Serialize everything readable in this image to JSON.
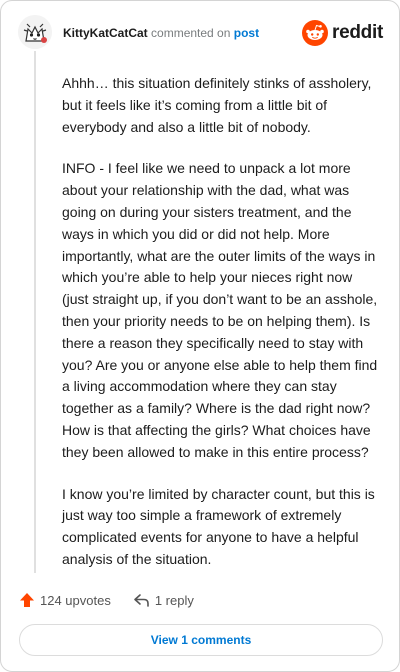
{
  "comment": {
    "username": "KittyKatCatCat",
    "verb": "commented on",
    "post_link": "post",
    "brand": "reddit",
    "paragraphs": [
      "Ahhh… this situation definitely stinks of assholery, but it feels like it’s coming from a little bit of everybody and also a little bit of nobody.",
      "INFO - I feel like we need to unpack a lot more about your relationship with the dad, what was going on during your sisters treatment, and the ways in which you did or did not help. More importantly, what are the outer limits of the ways in which you’re able to help your nieces right now (just straight up, if you don’t want to be an asshole, then your priority needs to be on helping them). Is there a reason they specifically need to stay with you? Are you or anyone else able to help them find a living accommodation where they can stay together as a family? Where is the dad right now? How is that affecting the girls? What choices have they been allowed to make in this entire process?",
      "I know you’re limited by character count, but this is just way too simple a framework of extremely complicated events for anyone to have a helpful analysis of the situation."
    ]
  },
  "actions": {
    "upvotes_label": "124 upvotes",
    "reply_label": "1 reply"
  },
  "footer": {
    "view_comments_label": "View 1 comments"
  },
  "icons": {
    "upvote": "upvote-arrow-icon",
    "reply": "reply-arrow-icon",
    "brand": "reddit-logo-icon",
    "avatar": "user-avatar"
  },
  "colors": {
    "upvote": "#ff4500",
    "link": "#0079d3",
    "muted": "#787c7e",
    "brand_orange": "#ff4500"
  }
}
